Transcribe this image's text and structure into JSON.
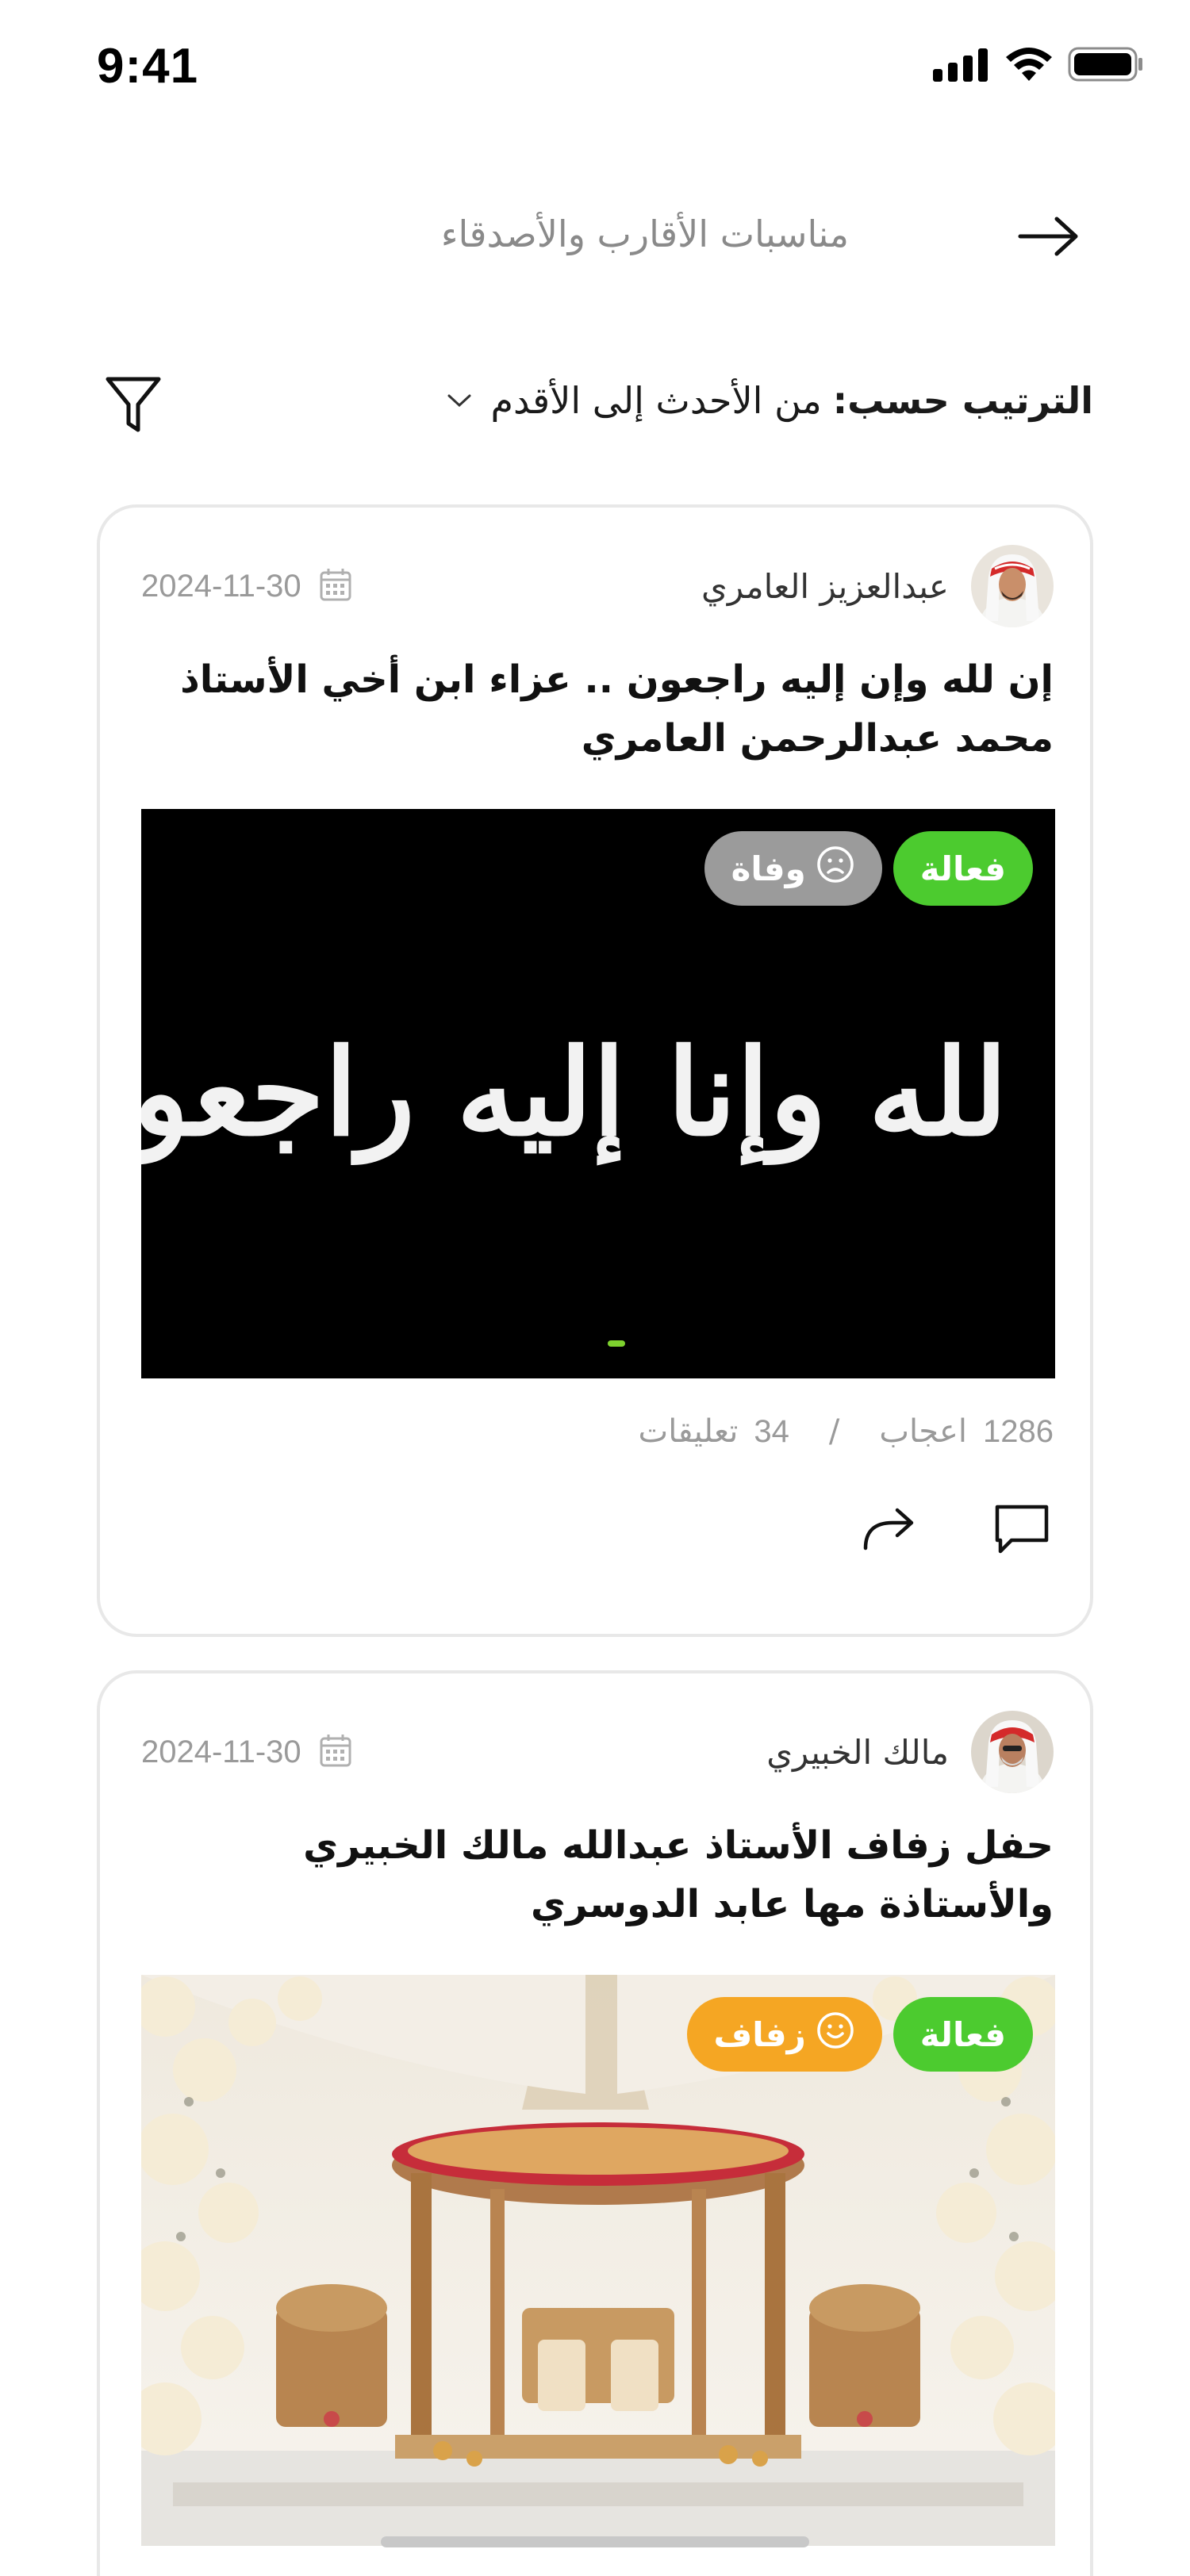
{
  "status_bar": {
    "time": "9:41"
  },
  "header": {
    "title": "مناسبات الأقارب والأصدقاء"
  },
  "sort": {
    "label": "الترتيب حسب:",
    "value": "من الأحدث إلى الأقدم"
  },
  "posts": [
    {
      "author": "عبدالعزيز العامري",
      "date": "2024-11-30",
      "title": "إن لله وإن إليه راجعون .. عزاء ابن أخي الأستاذ محمد عبدالرحمن العامري",
      "badge_status": "فعالة",
      "badge_type": "وفاة",
      "image_text": "إنا لله وإنا إليه راجعون",
      "likes_count": "1286",
      "likes_label": "اعجاب",
      "separator": "/",
      "comments_count": "34",
      "comments_label": "تعليقات"
    },
    {
      "author": "مالك الخبيري",
      "date": "2024-11-30",
      "title": "حفل زفاف الأستاذ عبدالله مالك الخبيري والأستاذة مها عابد الدوسري",
      "badge_status": "فعالة",
      "badge_type": "زفاف"
    }
  ],
  "colors": {
    "active_badge": "#4ccb2f",
    "death_badge": "#9b9b9b",
    "wedding_badge": "#f5a623",
    "pager_dot": "#7dd12e"
  },
  "icons": [
    "signal-icon",
    "wifi-icon",
    "battery-icon",
    "back-arrow-icon",
    "chevron-down-icon",
    "filter-icon",
    "calendar-icon",
    "sad-face-icon",
    "smile-face-icon",
    "share-icon",
    "comment-icon"
  ]
}
